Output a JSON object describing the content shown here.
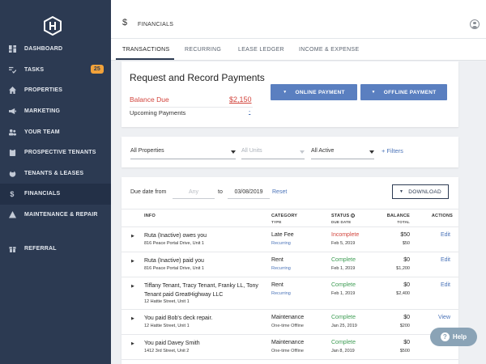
{
  "sidebar": {
    "items": [
      {
        "label": "DASHBOARD",
        "icon": "dashboard-icon"
      },
      {
        "label": "TASKS",
        "icon": "tasks-icon",
        "badge": "25"
      },
      {
        "label": "PROPERTIES",
        "icon": "home-icon"
      },
      {
        "label": "MARKETING",
        "icon": "megaphone-icon"
      },
      {
        "label": "YOUR TEAM",
        "icon": "team-icon"
      },
      {
        "label": "PROSPECTIVE TENANTS",
        "icon": "clipboard-icon"
      },
      {
        "label": "TENANTS & LEASES",
        "icon": "leases-icon"
      },
      {
        "label": "FINANCIALS",
        "icon": "dollar-icon",
        "active": true
      },
      {
        "label": "MAINTENANCE & REPAIR",
        "icon": "warning-icon"
      },
      {
        "label": "REFERRAL",
        "icon": "gift-icon"
      }
    ]
  },
  "header": {
    "icon": "$",
    "title": "FINANCIALS"
  },
  "tabs": [
    "TRANSACTIONS",
    "RECURRING",
    "LEASE LEDGER",
    "INCOME & EXPENSE"
  ],
  "payments": {
    "title": "Request and Record Payments",
    "balance_label": "Balance Due",
    "balance_value": "$2,150",
    "upcoming_label": "Upcoming Payments",
    "upcoming_value": "-",
    "online_btn": "ONLINE PAYMENT",
    "offline_btn": "OFFLINE PAYMENT"
  },
  "filters": {
    "properties": "All Properties",
    "units": "All Units",
    "status": "All Active",
    "add": "+ Filters"
  },
  "table": {
    "due_label": "Due date from",
    "from_placeholder": "Any",
    "to_label": "to",
    "to_value": "03/08/2019",
    "reset": "Reset",
    "download": "DOWNLOAD",
    "headers": {
      "info": "INFO",
      "category": "CATEGORY",
      "category_sub": "TYPE",
      "status": "STATUS",
      "status_sub": "DUE DATE",
      "balance": "BALANCE",
      "balance_sub": "TOTAL",
      "actions": "ACTIONS"
    },
    "rows": [
      {
        "info": "Ruta (Inactive) owes you",
        "addr": "816 Peace Portal Drive, Unit 1",
        "category": "Late Fee",
        "type": "Recurring",
        "status": "Incomplete",
        "date": "Feb 5, 2019",
        "balance": "$50",
        "total": "$50",
        "action": "Edit"
      },
      {
        "info": "Ruta (Inactive) paid you",
        "addr": "816 Peace Portal Drive, Unit 1",
        "category": "Rent",
        "type": "Recurring",
        "status": "Complete",
        "date": "Feb 1, 2019",
        "balance": "$0",
        "total": "$1,200",
        "action": "Edit"
      },
      {
        "info": "Tiffany Tenant, Tracy Tenant, Franky LL, Tony Tenant paid GreatHighway LLC",
        "addr": "12 Hattie Street, Unit 1",
        "category": "Rent",
        "type": "Recurring",
        "status": "Complete",
        "date": "Feb 1, 2019",
        "balance": "$0",
        "total": "$2,400",
        "action": "Edit"
      },
      {
        "info": "You paid Bob's deck repair.",
        "addr": "12 Hattie Street, Unit 1",
        "category": "Maintenance",
        "type": "One-time Offline",
        "status": "Complete",
        "date": "Jan 25, 2019",
        "balance": "$0",
        "total": "$200",
        "action": "View"
      },
      {
        "info": "You paid Davey Smith",
        "addr": "1412 3rd Street, Unit 2",
        "category": "Maintenance",
        "type": "One-time Offline",
        "status": "Complete",
        "date": "Jan 8, 2019",
        "balance": "$0",
        "total": "$500",
        "action": ""
      }
    ]
  },
  "help": "Help"
}
